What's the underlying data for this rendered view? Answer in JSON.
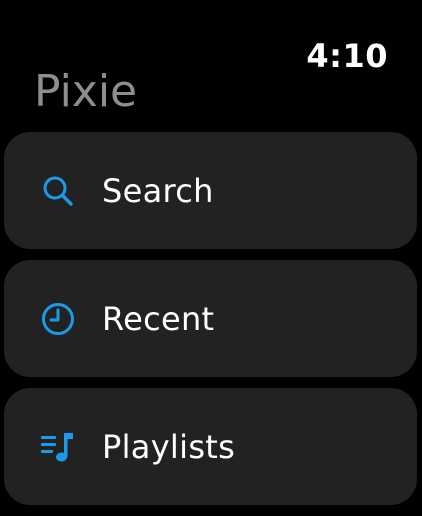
{
  "status": {
    "time": "4:10"
  },
  "app": {
    "title": "Pixie"
  },
  "menu": {
    "items": [
      {
        "label": "Search",
        "icon": "search-icon"
      },
      {
        "label": "Recent",
        "icon": "clock-icon"
      },
      {
        "label": "Playlists",
        "icon": "playlist-icon"
      }
    ]
  },
  "colors": {
    "background": "#000000",
    "card": "#222222",
    "accent": "#1a9bea",
    "title": "#8e8e8e"
  }
}
